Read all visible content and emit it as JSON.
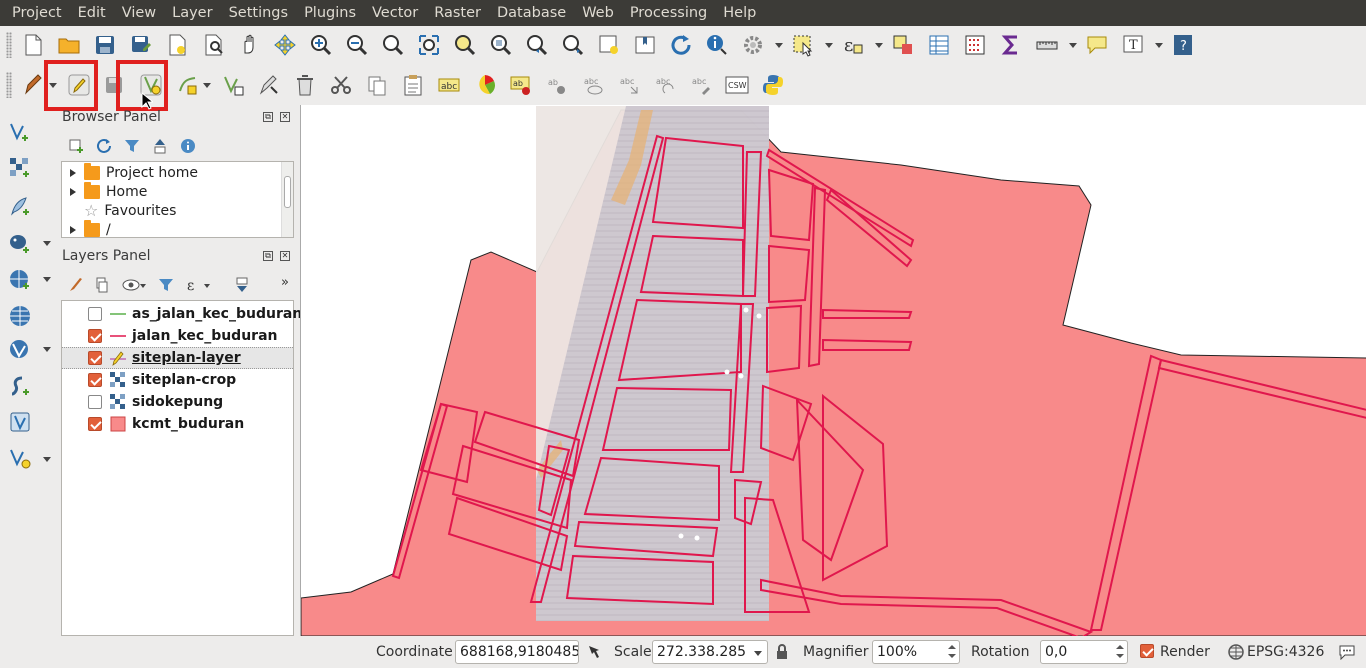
{
  "menu": [
    "Project",
    "Edit",
    "View",
    "Layer",
    "Settings",
    "Plugins",
    "Vector",
    "Raster",
    "Database",
    "Web",
    "Processing",
    "Help"
  ],
  "browser_panel": {
    "title": "Browser Panel",
    "items": [
      "Project home",
      "Home",
      "Favourites",
      "/"
    ]
  },
  "layers_panel": {
    "title": "Layers Panel",
    "layers": [
      {
        "name": "as_jalan_kec_buduran",
        "checked": false,
        "symbol": "line-green"
      },
      {
        "name": "jalan_kec_buduran",
        "checked": true,
        "symbol": "line-red"
      },
      {
        "name": "siteplan-layer",
        "checked": true,
        "symbol": "line-edit",
        "selected": true
      },
      {
        "name": "siteplan-crop",
        "checked": true,
        "symbol": "raster"
      },
      {
        "name": "sidokepung",
        "checked": false,
        "symbol": "raster"
      },
      {
        "name": "kcmt_buduran",
        "checked": true,
        "symbol": "fill-salmon"
      }
    ]
  },
  "toolbar_labels": {
    "abc": "abc",
    "csw": "CSW"
  },
  "statusbar": {
    "coordinate_label": "Coordinate",
    "coordinate_value": "688168,9180485",
    "scale_label": "Scale",
    "scale_value": "272.338.285",
    "magnifier_label": "Magnifier",
    "magnifier_value": "100%",
    "rotation_label": "Rotation",
    "rotation_value": "0,0",
    "render_label": "Render",
    "render_checked": true,
    "crs_label": "EPSG:4326"
  },
  "colors": {
    "polygon_fill": "#f88a8a",
    "road_stroke": "#e0174d",
    "highlight": "#e0201e",
    "menubar": "#3c3b37"
  }
}
